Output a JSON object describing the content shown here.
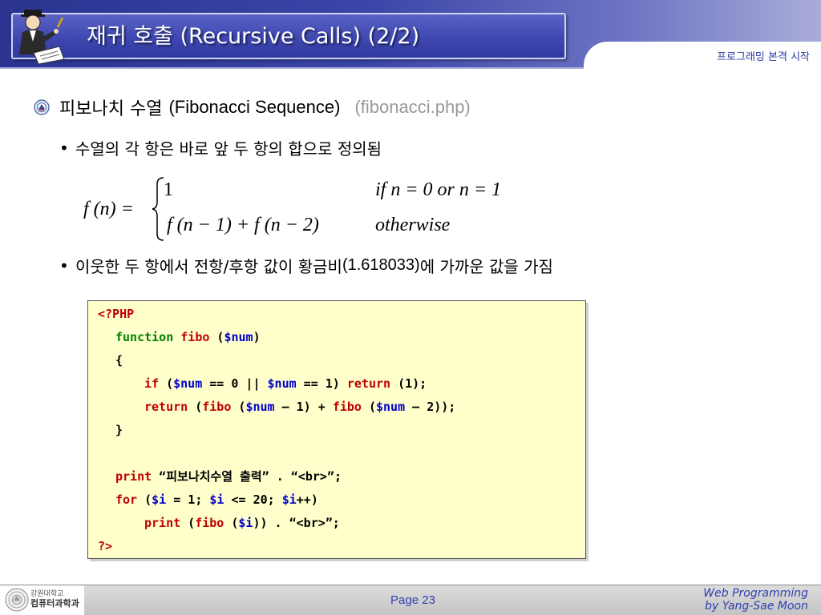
{
  "header": {
    "title": "재귀 호출 (Recursive Calls) (2/2)",
    "section": "프로그래밍 본격 시작"
  },
  "bullets": {
    "main": {
      "label_ko": "피보나치 수열",
      "label_en": "(Fibonacci Sequence)",
      "file": "(fibonacci.php)"
    },
    "sub1": "수열의 각 항은 바로 앞 두 항의 합으로 정의됨",
    "sub2_before": "이웃한 두 항에서 전항/후항 값이 황금비",
    "sub2_ratio": "(1.618033)",
    "sub2_after": "에 가까운 값을 가짐"
  },
  "formula": {
    "lhs": "f (n) =",
    "case1_value": "1",
    "case1_condition": "if  n = 0 or n = 1",
    "case2_value": "f (n − 1) + f (n − 2)",
    "case2_condition": "otherwise"
  },
  "code": {
    "l1": "<?PHP",
    "l2_kw": "function",
    "l2_fn": "fibo",
    "l2_rest_open": " (",
    "l2_var": "$num",
    "l2_rest_close": ")",
    "l3": "{",
    "l4_kw": "if",
    "l4_a": " (",
    "l4_v1": "$num",
    "l4_b": " == 0 || ",
    "l4_v2": "$num",
    "l4_c": " == 1) ",
    "l4_kw2": "return",
    "l4_d": " (1);",
    "l5_kw": "return",
    "l5_a": " (",
    "l5_fn1": "fibo",
    "l5_b": " (",
    "l5_v1": "$num",
    "l5_c": " – 1) + ",
    "l5_fn2": "fibo",
    "l5_d": " (",
    "l5_v2": "$num",
    "l5_e": " – 2));",
    "l6": "}",
    "l8_kw": "print",
    "l8_rest": " “피보나치수열 출력” . “<br>”;",
    "l9_kw": "for",
    "l9_a": " (",
    "l9_v1": "$i",
    "l9_b": " = 1; ",
    "l9_v2": "$i",
    "l9_c": " <= 20; ",
    "l9_v3": "$i",
    "l9_d": "++)",
    "l10_kw": "print",
    "l10_a": " (",
    "l10_fn": "fibo",
    "l10_b": " (",
    "l10_v": "$i",
    "l10_c": ")) . “<br>”;",
    "l11": "?>"
  },
  "footer": {
    "school_line1": "강원대학교",
    "school_line2": "컴퓨터과학과",
    "page": "Page 23",
    "credit_line1": "Web Programming",
    "credit_line2": "by Yang-Sae Moon"
  },
  "colors": {
    "header_dark": "#2a3490",
    "title_text": "#ffffff",
    "code_bg": "#ffffcc",
    "code_keyword": "#c00000",
    "code_function": "#008000",
    "code_variable": "#0000cc",
    "footer_accent": "#2f3fb0"
  },
  "icons": [
    "teacher-clipart-icon",
    "university-emblem-icon",
    "bullet-emblem-icon"
  ]
}
